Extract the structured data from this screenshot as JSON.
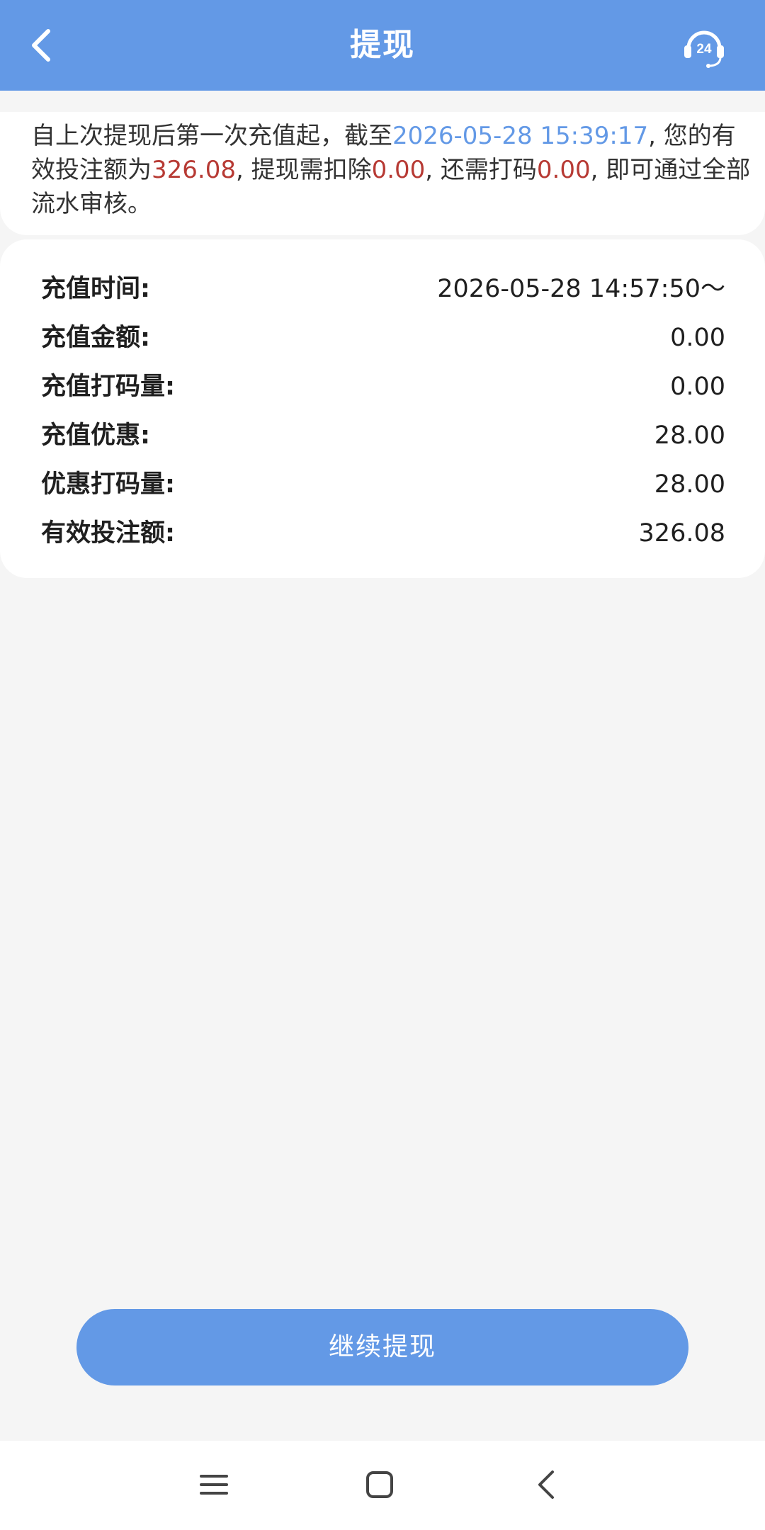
{
  "header": {
    "title": "提现",
    "support_badge": "24"
  },
  "notice": {
    "part1": "自上次提现后第一次充值起，截至",
    "datetime": "2026-05-28 15:39:17",
    "part2": ", 您的有效投注额为",
    "valid_bet": "326.08",
    "part3": ", 提现需扣除",
    "deduction": "0.00",
    "part4": ", 还需打码",
    "remaining": "0.00",
    "part5": ", 即可通过全部流水审核。"
  },
  "details": [
    {
      "label": "充值时间:",
      "value": "2026-05-28 14:57:50～"
    },
    {
      "label": "充值金额:",
      "value": "0.00"
    },
    {
      "label": "充值打码量:",
      "value": "0.00"
    },
    {
      "label": "充值优惠:",
      "value": "28.00"
    },
    {
      "label": "优惠打码量:",
      "value": "28.00"
    },
    {
      "label": "有效投注额:",
      "value": "326.08"
    }
  ],
  "actions": {
    "continue_label": "继续提现"
  },
  "colors": {
    "primary": "#6399e6",
    "highlight_red": "#b73a34",
    "background": "#f5f5f5"
  },
  "icons": {
    "back": "chevron-left-icon",
    "support": "headset-24-icon",
    "nav_menu": "menu-icon",
    "nav_home": "square-home-icon",
    "nav_back": "chevron-left-icon"
  }
}
